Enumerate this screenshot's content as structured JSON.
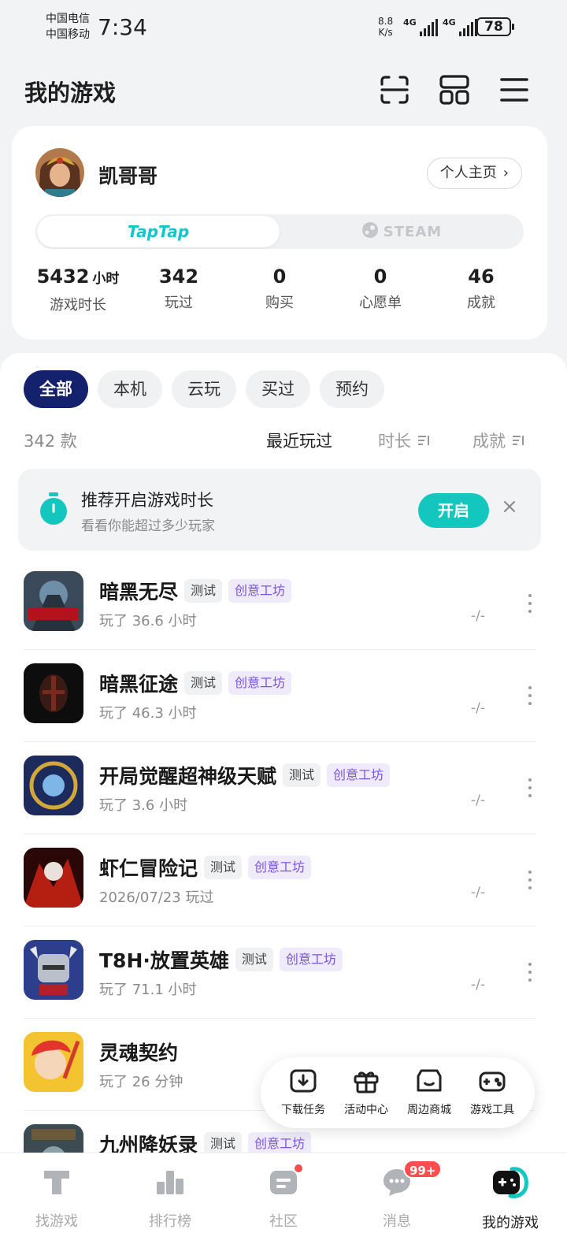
{
  "status_bar": {
    "carrier_1": "中国电信",
    "carrier_2": "中国移动",
    "time": "7:34",
    "net_speed_value": "8.8",
    "net_speed_unit": "K/s",
    "sim1_label": "4G",
    "sim2_label": "4G",
    "battery": "78"
  },
  "header": {
    "title": "我的游戏",
    "icons": [
      "scan-icon",
      "grid-icon",
      "menu-icon"
    ]
  },
  "profile": {
    "username": "凯哥哥",
    "home_button": "个人主页",
    "platforms": {
      "active": "TapTap",
      "inactive": "STEAM"
    },
    "stats": [
      {
        "value": "5432",
        "unit": "小时",
        "label": "游戏时长"
      },
      {
        "value": "342",
        "unit": "",
        "label": "玩过"
      },
      {
        "value": "0",
        "unit": "",
        "label": "购买"
      },
      {
        "value": "0",
        "unit": "",
        "label": "心愿单"
      },
      {
        "value": "46",
        "unit": "",
        "label": "成就"
      }
    ]
  },
  "filters": [
    "全部",
    "本机",
    "云玩",
    "买过",
    "预约"
  ],
  "list_header": {
    "count": "342 款",
    "sort_recent": "最近玩过",
    "sort_duration": "时长",
    "sort_achievement": "成就"
  },
  "tip": {
    "title": "推荐开启游戏时长",
    "subtitle": "看看你能超过多少玩家",
    "button": "开启"
  },
  "games": [
    {
      "name": "暗黑无尽",
      "tags": [
        "测试",
        "创意工坊"
      ],
      "meta": "玩了 36.6 小时",
      "achievement": "-/-"
    },
    {
      "name": "暗黑征途",
      "tags": [
        "测试",
        "创意工坊"
      ],
      "meta": "玩了 46.3 小时",
      "achievement": "-/-"
    },
    {
      "name": "开局觉醒超神级天赋",
      "tags": [
        "测试",
        "创意工坊"
      ],
      "meta": "玩了 3.6 小时",
      "achievement": "-/-"
    },
    {
      "name": "虾仁冒险记",
      "tags": [
        "测试",
        "创意工坊"
      ],
      "meta": "2026/07/23 玩过",
      "achievement": "-/-"
    },
    {
      "name": "T8H·放置英雄",
      "tags": [
        "测试",
        "创意工坊"
      ],
      "meta": "玩了 71.1 小时",
      "achievement": "-/-"
    },
    {
      "name": "灵魂契约",
      "tags": [],
      "meta": "玩了 26 分钟",
      "achievement": ""
    },
    {
      "name": "九州降妖录",
      "tags": [
        "测试",
        "创意工坊"
      ],
      "meta": "",
      "achievement": ""
    }
  ],
  "quick_tools": [
    "下载任务",
    "活动中心",
    "周边商城",
    "游戏工具"
  ],
  "bottom_nav": {
    "items": [
      "找游戏",
      "排行榜",
      "社区",
      "消息",
      "我的游戏"
    ],
    "active_index": 4,
    "message_badge": "99+"
  },
  "colors": {
    "accent": "#14c7be",
    "filter_active": "#14226e",
    "workshop_tag": "#7a55e0",
    "badge": "#ff4d4f"
  }
}
